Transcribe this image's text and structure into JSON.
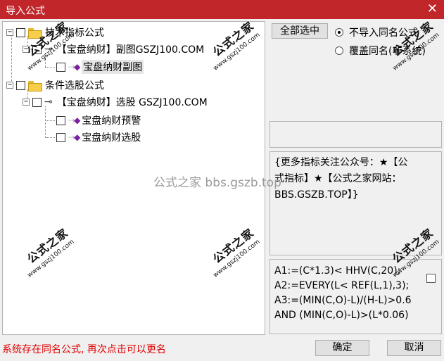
{
  "window": {
    "title": "导入公式",
    "close_glyph": "✕"
  },
  "tree": {
    "nodes": [
      {
        "label": "技术指标公式"
      },
      {
        "label": "【宝盘纳财】副图GSZJ100.COM"
      },
      {
        "label": "宝盘纳财副图"
      },
      {
        "label": "条件选股公式"
      },
      {
        "label": "【宝盘纳财】选股 GSZJ100.COM"
      },
      {
        "label": "宝盘纳财预警"
      },
      {
        "label": "宝盘纳财选股"
      }
    ],
    "expander_glyph": "−"
  },
  "buttons": {
    "select_all": "全部选中",
    "ok": "确定",
    "cancel": "取消"
  },
  "options": {
    "no_import_same": "不导入同名公式",
    "overwrite_same": "覆盖同名(非系统)"
  },
  "info_lines": [
    "{更多指标关注公众号：★【公",
    "式指标】★【公式之家网站：",
    "BBS.GSZB.TOP】}"
  ],
  "formula_lines": [
    "A1:=(C*1.3)< HHV(C,20);",
    "A2:=EVERY(L< REF(L,1),3);",
    "A3:=(MIN(C,O)-L)/(H-L)>0.6",
    "AND (MIN(C,O)-L)>(L*0.06)"
  ],
  "status": "系统存在同名公式, 再次点击可以更名",
  "watermark": {
    "center": "公式之家 bbs.gszb.top",
    "stamp_big": "公式之家",
    "stamp_small": "www.gszj100.com"
  }
}
